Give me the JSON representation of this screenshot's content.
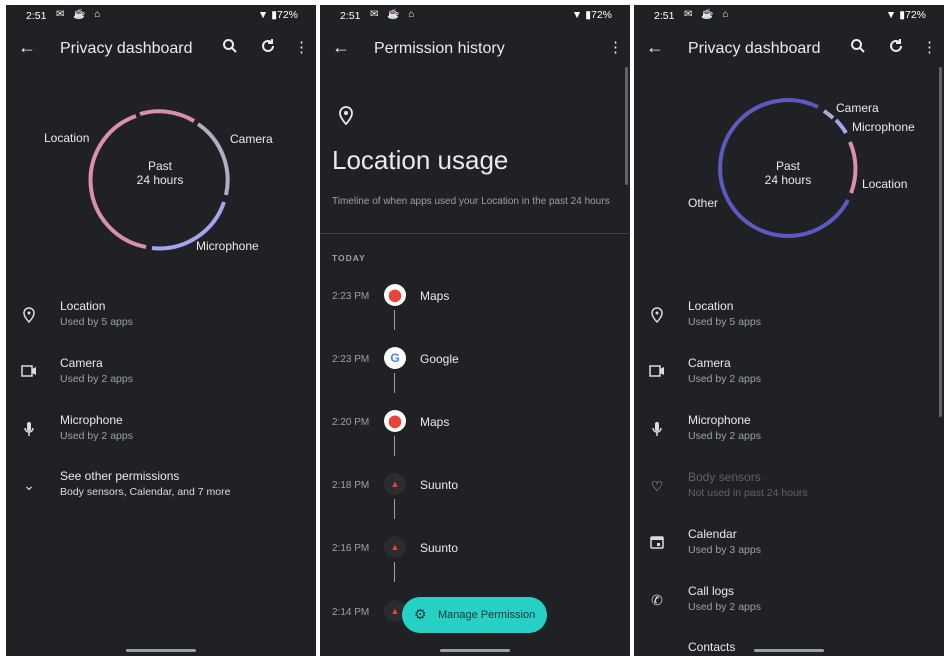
{
  "status": {
    "time": "2:51",
    "icons": "✉ ☕ ⌂",
    "battery": "▼ ▮72%"
  },
  "screen1": {
    "title": "Privacy dashboard",
    "ring": {
      "center_line1": "Past",
      "center_line2": "24 hours",
      "labels": {
        "location": "Location",
        "camera": "Camera",
        "microphone": "Microphone"
      }
    },
    "items": [
      {
        "title": "Location",
        "sub": "Used by 5 apps",
        "icon": "location-pin-icon"
      },
      {
        "title": "Camera",
        "sub": "Used by 2 apps",
        "icon": "camera-icon"
      },
      {
        "title": "Microphone",
        "sub": "Used by 2 apps",
        "icon": "microphone-icon"
      },
      {
        "title": "See other permissions",
        "sub": "Body sensors, Calendar, and 7 more",
        "icon": "chevron-down-icon"
      }
    ]
  },
  "screen2": {
    "title": "Permission history",
    "heading": "Location usage",
    "subtitle": "Timeline of when apps used your Location in the past 24 hours",
    "section": "TODAY",
    "entries": [
      {
        "time": "2:23 PM",
        "app": "Maps"
      },
      {
        "time": "2:23 PM",
        "app": "Google"
      },
      {
        "time": "2:20 PM",
        "app": "Maps"
      },
      {
        "time": "2:18 PM",
        "app": "Suunto"
      },
      {
        "time": "2:16 PM",
        "app": "Suunto"
      },
      {
        "time": "2:14 PM",
        "app": ""
      }
    ],
    "fab": "Manage Permission"
  },
  "screen3": {
    "title": "Privacy dashboard",
    "ring": {
      "center_line1": "Past",
      "center_line2": "24 hours",
      "labels": {
        "camera": "Camera",
        "microphone": "Microphone",
        "location": "Location",
        "other": "Other"
      }
    },
    "items": [
      {
        "title": "Location",
        "sub": "Used by 5 apps"
      },
      {
        "title": "Camera",
        "sub": "Used by 2 apps"
      },
      {
        "title": "Microphone",
        "sub": "Used by 2 apps"
      },
      {
        "title": "Body sensors",
        "sub": "Not used in past 24 hours"
      },
      {
        "title": "Calendar",
        "sub": "Used by 3 apps"
      },
      {
        "title": "Call logs",
        "sub": "Used by 2 apps"
      },
      {
        "title": "Contacts",
        "sub": ""
      }
    ]
  },
  "colors": {
    "location": "#d98fb0",
    "camera": "#b0adc6",
    "microphone": "#a3a5ef",
    "other": "#5b5bbf",
    "fab": "#26d0c4",
    "background": "#202124"
  }
}
